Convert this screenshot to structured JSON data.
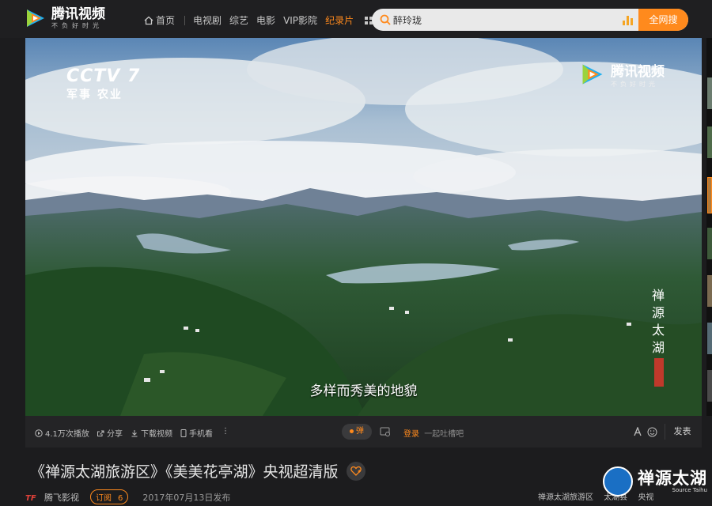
{
  "header": {
    "logo_name": "腾讯视频",
    "logo_slogan": "不负好时光",
    "nav": [
      {
        "label": "首页",
        "active": false
      },
      {
        "label": "电视剧",
        "active": false
      },
      {
        "label": "综艺",
        "active": false
      },
      {
        "label": "电影",
        "active": false
      },
      {
        "label": "VIP影院",
        "active": false
      },
      {
        "label": "纪录片",
        "active": true
      }
    ],
    "search_value": "醉玲珑",
    "search_button": "全网搜"
  },
  "player": {
    "channel_logo": "CCTV 7",
    "channel_sub": "军事 农业",
    "watermark_name": "腾讯视频",
    "watermark_slogan": "不负好时光",
    "vertical_title": "禅源太湖",
    "subtitle": "多样而秀美的地貌"
  },
  "controls": {
    "plays": "4.1万次播放",
    "share": "分享",
    "download": "下载视频",
    "mobile": "手机看",
    "more": "⋮",
    "danmu_toggle": "弹",
    "danmu_login": "登录",
    "danmu_placeholder": "一起吐槽吧",
    "send": "发表"
  },
  "video": {
    "title": "《禅源太湖旅游区》《美美花亭湖》央视超清版"
  },
  "meta": {
    "uploader": "腾飞影视",
    "subscribe_label": "订阅",
    "subscribe_count": "6",
    "published": "2017年07月13日发布",
    "tags": [
      "禅源太湖旅游区",
      "太湖县",
      "央视"
    ]
  },
  "badge": {
    "name": "禅源太湖",
    "sub": "Source Taihu"
  },
  "colors": {
    "accent": "#ff8a1d",
    "background": "#1c1c1e",
    "badge_blue": "#1a6fc4"
  },
  "icons": [
    "home-icon",
    "grid-icon",
    "search-icon",
    "hot-bars-icon",
    "play-count-icon",
    "share-icon",
    "download-icon",
    "mobile-icon",
    "danmu-settings-icon",
    "font-icon",
    "emoji-icon",
    "favorite-icon"
  ]
}
